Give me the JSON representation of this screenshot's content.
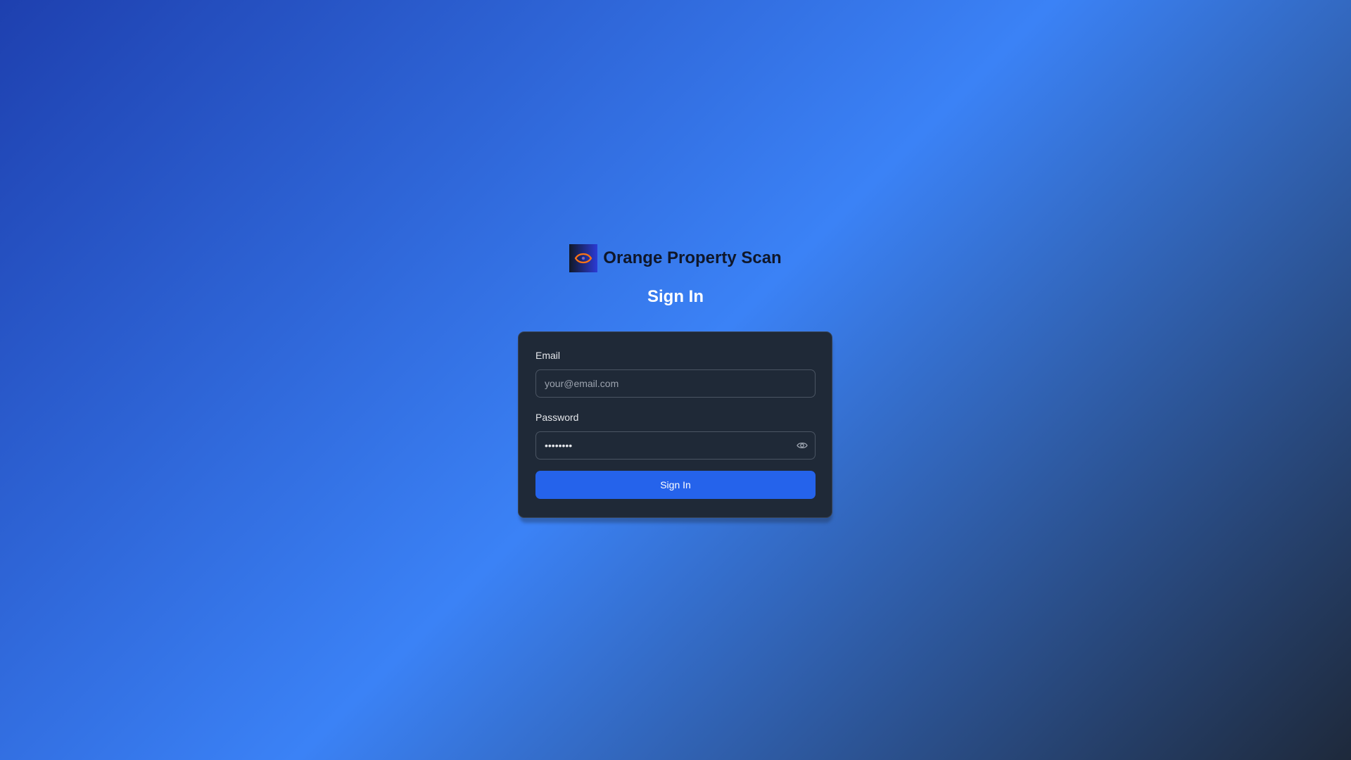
{
  "brand": {
    "name": "Orange Property Scan",
    "logo_icon": "eye-icon",
    "logo_colors": {
      "eye": "#f97316",
      "background_from": "#111827",
      "background_to": "#2b3bd6"
    }
  },
  "heading": "Sign In",
  "form": {
    "email": {
      "label": "Email",
      "value": "",
      "placeholder": "your@email.com"
    },
    "password": {
      "label": "Password",
      "value": "••••••••",
      "toggle_icon": "eye-icon"
    },
    "submit_label": "Sign In"
  },
  "colors": {
    "background_from": "#1e40af",
    "background_mid": "#3b82f6",
    "background_to": "#1e293b",
    "card": "#1f2937",
    "button": "#2563eb"
  }
}
